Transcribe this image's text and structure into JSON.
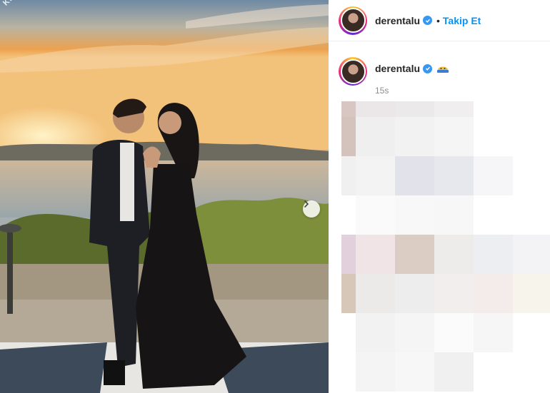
{
  "post": {
    "username": "derentalu",
    "follow_label": "Takip Et",
    "separator": "•",
    "time_ago": "15s",
    "watermark": "KE"
  },
  "icons": {
    "verified": "verified-badge-icon",
    "next": "chevron-right-icon",
    "caption_emoji": "crying-face-emoji-icon"
  },
  "colors": {
    "link": "#0095f6",
    "verified": "#3897f0",
    "text": "#262626",
    "muted": "#8e8e8e"
  }
}
